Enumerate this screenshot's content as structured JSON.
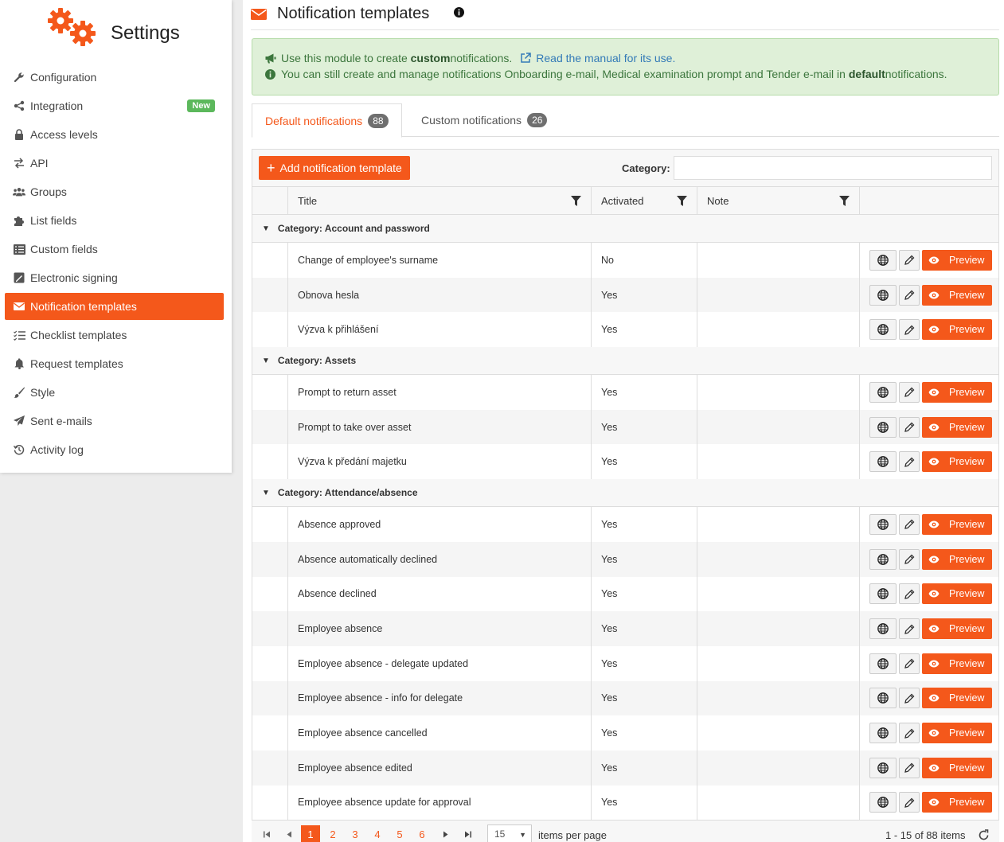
{
  "sidebar": {
    "title": "Settings",
    "items": [
      {
        "label": "Configuration",
        "icon": "wrench-icon"
      },
      {
        "label": "Integration",
        "icon": "share-icon",
        "badge": "New"
      },
      {
        "label": "Access levels",
        "icon": "lock-icon"
      },
      {
        "label": "API",
        "icon": "exchange-icon"
      },
      {
        "label": "Groups",
        "icon": "users-icon"
      },
      {
        "label": "List fields",
        "icon": "puzzle-icon"
      },
      {
        "label": "Custom fields",
        "icon": "list-icon"
      },
      {
        "label": "Electronic signing",
        "icon": "signature-icon"
      },
      {
        "label": "Notification templates",
        "icon": "envelope-icon",
        "active": true
      },
      {
        "label": "Checklist templates",
        "icon": "checklist-icon"
      },
      {
        "label": "Request templates",
        "icon": "bell-icon"
      },
      {
        "label": "Style",
        "icon": "brush-icon"
      },
      {
        "label": "Sent e-mails",
        "icon": "paper-plane-icon"
      },
      {
        "label": "Activity log",
        "icon": "history-icon"
      }
    ]
  },
  "page": {
    "title": "Notification templates"
  },
  "alert": {
    "line1_pre": "Use this module to create ",
    "line1_bold": "custom",
    "line1_post": " notifications.",
    "manual_link": "Read the manual for its use.",
    "line2_pre": "You can still create and manage notifications Onboarding e-mail, Medical examination prompt and Tender e-mail in ",
    "line2_bold": "default",
    "line2_post": " notifications."
  },
  "tabs": [
    {
      "label": "Default notifications",
      "count": "88"
    },
    {
      "label": "Custom notifications",
      "count": "26"
    }
  ],
  "toolbar": {
    "add_label": "Add notification template",
    "category_label": "Category:",
    "category_value": ""
  },
  "columns": {
    "title": "Title",
    "activated": "Activated",
    "note": "Note"
  },
  "preview_label": "Preview",
  "groups": [
    {
      "label": "Category: Account and password",
      "rows": [
        {
          "title": "Change of employee's surname",
          "activated": "No",
          "note": ""
        },
        {
          "title": "Obnova hesla",
          "activated": "Yes",
          "note": ""
        },
        {
          "title": "Výzva k přihlášení",
          "activated": "Yes",
          "note": ""
        }
      ]
    },
    {
      "label": "Category: Assets",
      "rows": [
        {
          "title": "Prompt to return asset",
          "activated": "Yes",
          "note": ""
        },
        {
          "title": "Prompt to take over asset",
          "activated": "Yes",
          "note": ""
        },
        {
          "title": "Výzva k předání majetku",
          "activated": "Yes",
          "note": ""
        }
      ]
    },
    {
      "label": "Category: Attendance/absence",
      "rows": [
        {
          "title": "Absence approved",
          "activated": "Yes",
          "note": ""
        },
        {
          "title": "Absence automatically declined",
          "activated": "Yes",
          "note": ""
        },
        {
          "title": "Absence declined",
          "activated": "Yes",
          "note": ""
        },
        {
          "title": "Employee absence",
          "activated": "Yes",
          "note": ""
        },
        {
          "title": "Employee absence - delegate updated",
          "activated": "Yes",
          "note": ""
        },
        {
          "title": "Employee absence - info for delegate",
          "activated": "Yes",
          "note": ""
        },
        {
          "title": "Employee absence cancelled",
          "activated": "Yes",
          "note": ""
        },
        {
          "title": "Employee absence edited",
          "activated": "Yes",
          "note": ""
        },
        {
          "title": "Employee absence update for approval",
          "activated": "Yes",
          "note": ""
        }
      ]
    }
  ],
  "pager": {
    "pages": [
      "1",
      "2",
      "3",
      "4",
      "5",
      "6"
    ],
    "current": "1",
    "per_page": "15",
    "per_page_label": "items per page",
    "summary": "1 - 15 of 88 items"
  },
  "colors": {
    "accent": "#f4581b",
    "success_bg": "#dff0d8",
    "badge_green": "#5cb85c"
  }
}
